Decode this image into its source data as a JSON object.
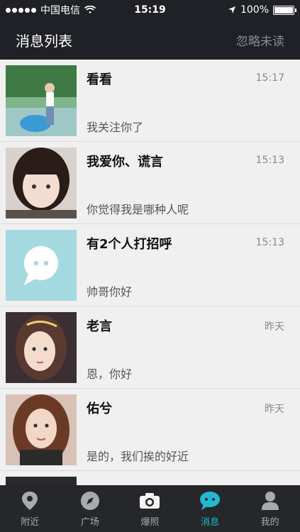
{
  "status_bar": {
    "carrier": "中国电信",
    "time": "15:19",
    "battery": "100%"
  },
  "nav": {
    "title": "消息列表",
    "action": "忽略未读"
  },
  "messages": [
    {
      "name": "看看",
      "time": "15:17",
      "preview": "我关注你了"
    },
    {
      "name": "我爱你、谎言",
      "time": "15:13",
      "preview": "你觉得我是哪种人呢"
    },
    {
      "name": "有2个人打招呼",
      "time": "15:13",
      "preview": "帅哥你好"
    },
    {
      "name": "老言",
      "time": "昨天",
      "preview": "恩，你好"
    },
    {
      "name": "佑兮",
      "time": "昨天",
      "preview": "是的，我们挨的好近"
    }
  ],
  "tabs": [
    {
      "label": "附近",
      "icon": "location-pin-icon"
    },
    {
      "label": "广场",
      "icon": "compass-icon"
    },
    {
      "label": "爆照",
      "icon": "camera-icon"
    },
    {
      "label": "消息",
      "icon": "chat-bubble-icon"
    },
    {
      "label": "我的",
      "icon": "person-icon"
    }
  ],
  "colors": {
    "accent": "#22b8cf",
    "dark_bg": "#1f2126",
    "list_bg": "#f0f0f0"
  }
}
